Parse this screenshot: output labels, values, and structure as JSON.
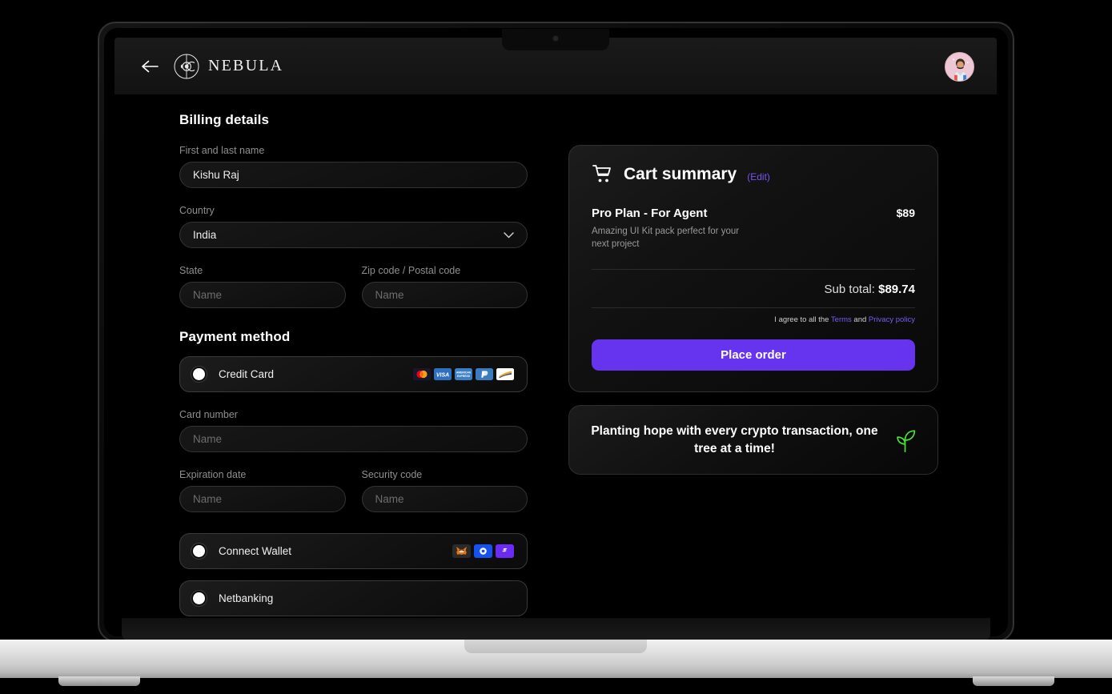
{
  "app": {
    "brand_name": "NEBULA",
    "back_icon": "arrow-left-icon",
    "logo_icon": "nebula-eclipse-logo",
    "avatar_alt": "user-avatar"
  },
  "billing": {
    "heading": "Billing details",
    "fields": {
      "name_label": "First and last name",
      "name_value": "Kishu Raj",
      "country_label": "Country",
      "country_value": "India",
      "state_label": "State",
      "state_placeholder": "Name",
      "zip_label": "Zip code / Postal code",
      "zip_placeholder": "Name"
    }
  },
  "payment": {
    "heading": "Payment method",
    "options": [
      {
        "label": "Credit Card",
        "selected": true,
        "icons": [
          "mastercard-icon",
          "visa-icon",
          "amex-icon",
          "paypal-icon",
          "discover-icon"
        ]
      },
      {
        "label": "Connect Wallet",
        "selected": false,
        "icons": [
          "metamask-icon",
          "coinbase-wallet-icon",
          "walletconnect-icon"
        ]
      },
      {
        "label": "Netbanking",
        "selected": false,
        "icons": []
      }
    ],
    "card_fields": {
      "card_number_label": "Card number",
      "card_number_placeholder": "Name",
      "expiry_label": "Expiration date",
      "expiry_placeholder": "Name",
      "cvv_label": "Security code",
      "cvv_placeholder": "Name"
    }
  },
  "cart": {
    "title": "Cart summary",
    "edit_label": "(Edit)",
    "cart_icon": "shopping-cart-icon",
    "item": {
      "name": "Pro Plan - For Agent",
      "description": "Amazing UI Kit pack perfect for your next project",
      "price": "$89"
    },
    "subtotal_label": "Sub total:",
    "subtotal_value": "$89.74",
    "terms_prefix": "I agree to all the",
    "terms_link": "Terms",
    "terms_and": "and",
    "privacy_link": "Privacy policy",
    "place_order_label": "Place order"
  },
  "eco_banner": {
    "text": "Planting hope with every crypto transaction, one tree at a time!",
    "icon": "sprout-leaf-icon",
    "icon_color": "#4ade3a"
  },
  "colors": {
    "accent": "#6633ee",
    "link": "#7755ee",
    "background": "#000000",
    "card": "#121212",
    "border": "#333333",
    "muted_text": "#8f8f8f"
  }
}
